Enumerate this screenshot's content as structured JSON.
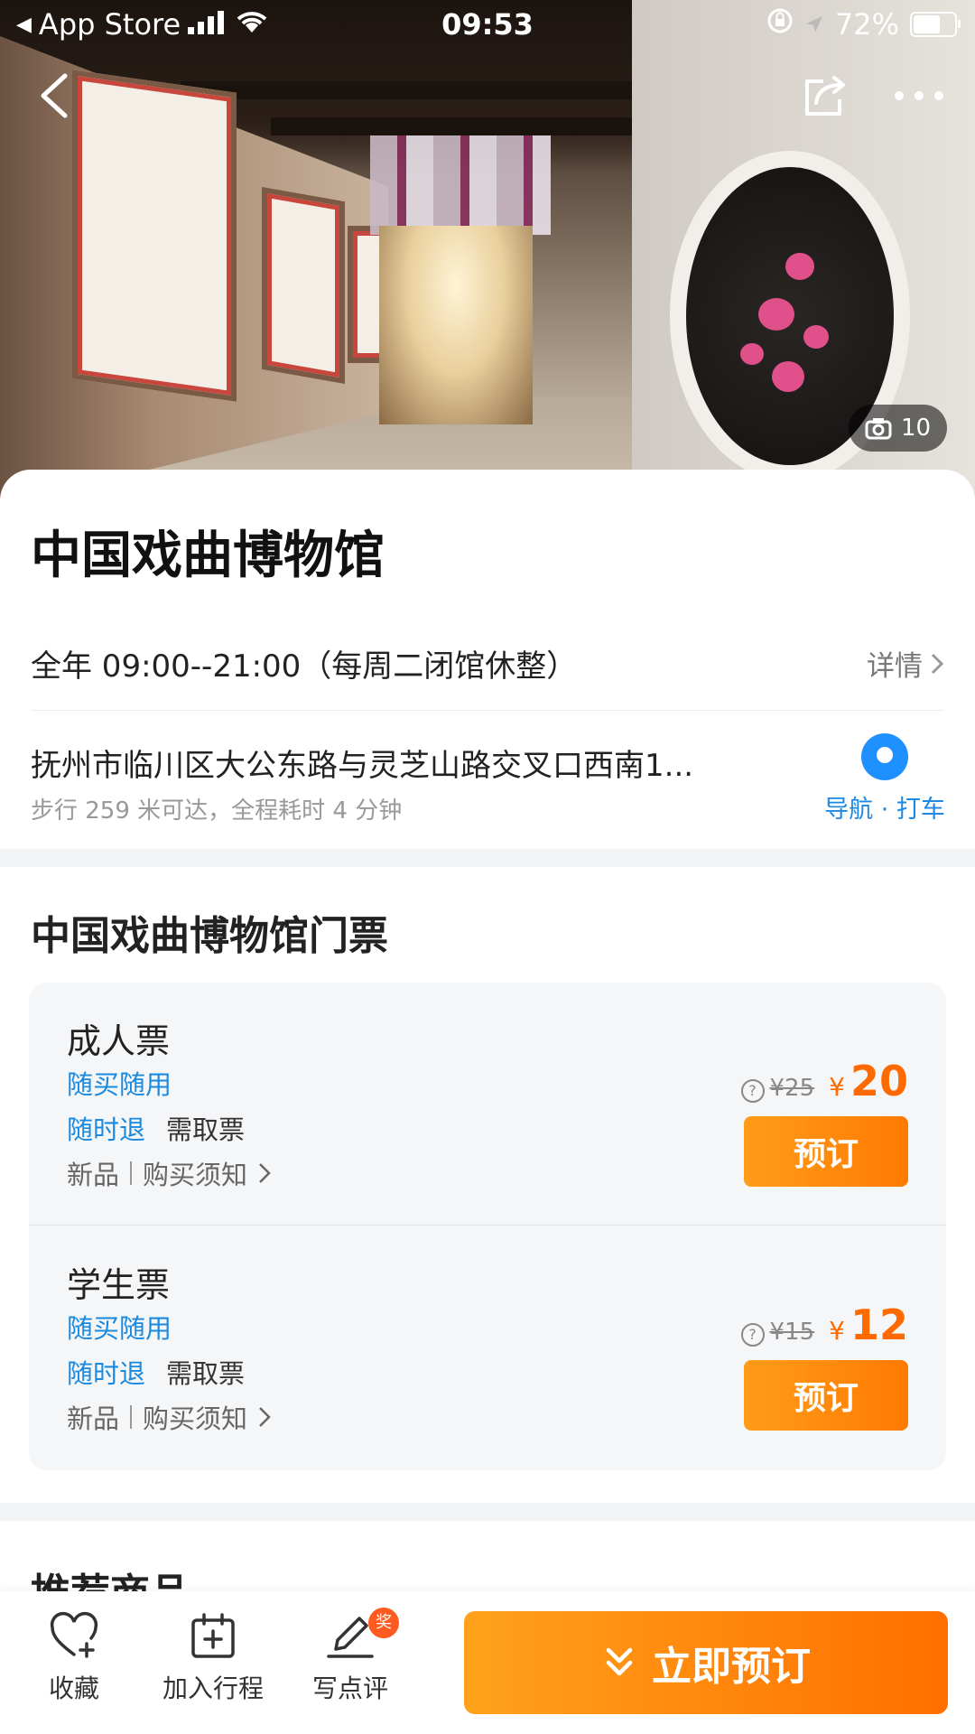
{
  "status_bar": {
    "back_app": "App Store",
    "time": "09:53",
    "battery": "72%",
    "battery_level": 0.72
  },
  "hero": {
    "photo_count": "10"
  },
  "poi": {
    "title": "中国戏曲博物馆",
    "hours": "全年 09:00--21:00（每周二闭馆休整）",
    "detail_link": "详情",
    "address": "抚州市临川区大公东路与灵芝山路交叉口西南1...",
    "walk_info": "步行 259 米可达，全程耗时 4 分钟",
    "nav_label": "导航 · 打车"
  },
  "tickets_section": {
    "title": "中国戏曲博物馆门票",
    "tickets": [
      {
        "name": "成人票",
        "tag1": "随买随用",
        "tag2": "随时退",
        "tag2_extra": "需取票",
        "link1": "新品",
        "link2": "购买须知",
        "old_price": "¥25",
        "currency": "¥",
        "price": "20",
        "book_label": "预订"
      },
      {
        "name": "学生票",
        "tag1": "随买随用",
        "tag2": "随时退",
        "tag2_extra": "需取票",
        "link1": "新品",
        "link2": "购买须知",
        "old_price": "¥15",
        "currency": "¥",
        "price": "12",
        "book_label": "预订"
      }
    ]
  },
  "recommend": {
    "title": "推荐商品"
  },
  "bottom_bar": {
    "favorite": "收藏",
    "add_itinerary": "加入行程",
    "write_review": "写点评",
    "review_badge": "奖",
    "book_now": "立即预订"
  },
  "colors": {
    "accent_orange": "#ff7a00",
    "link_blue": "#1a8ae0"
  }
}
